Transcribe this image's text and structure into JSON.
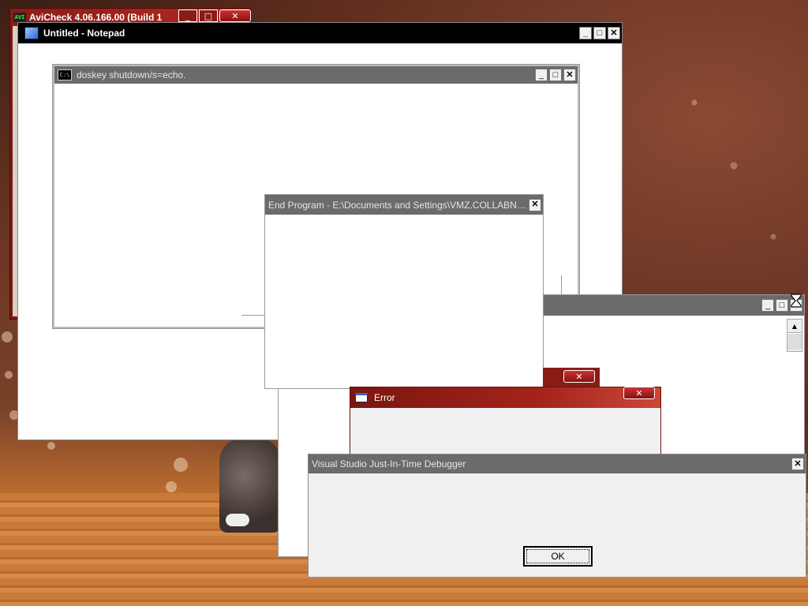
{
  "windows": {
    "avicheck": {
      "title": "AviCheck 4.06.166.00 (Build 1",
      "icon": "AVI"
    },
    "notepad": {
      "title": "Untitled - Notepad"
    },
    "cmd": {
      "title": "doskey shutdown/s=echo.",
      "icon": "C:\\"
    },
    "endprog": {
      "title": "End Program - E:\\Documents and Settings\\VMZ.COLLABNE..."
    },
    "error": {
      "title": "Error"
    },
    "debugger": {
      "title": "Visual Studio Just-In-Time Debugger",
      "ok_label": "OK"
    }
  },
  "buttons": {
    "minimize": "_",
    "maximize": "□",
    "close": "✕",
    "scroll_up": "▲"
  },
  "colors": {
    "title_gray": "#6b6b6b",
    "xp_red": "#a3231a",
    "notepad_black": "#000000"
  }
}
